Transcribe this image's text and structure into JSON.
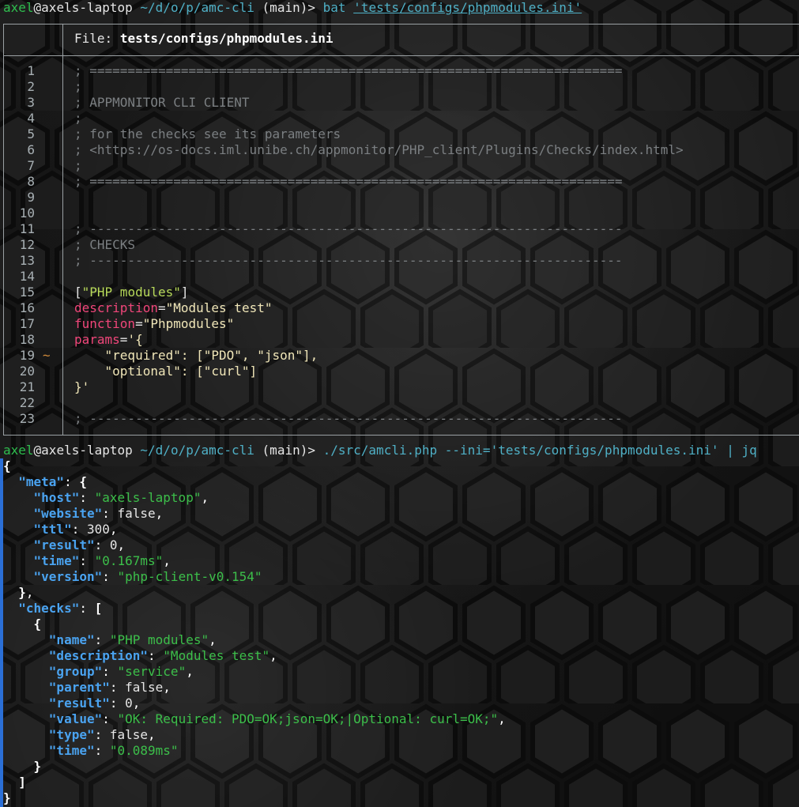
{
  "prompt1": {
    "user": "axel",
    "at": "@",
    "host": "axels-laptop",
    "cwd": "~/d/o/p/amc-cli",
    "branch": "(main)",
    "symbol": ">",
    "command": "bat",
    "argument": "'tests/configs/phpmodules.ini'"
  },
  "bat": {
    "file_label": "File:",
    "file_name": "tests/configs/phpmodules.ini",
    "line_numbers": [
      "1",
      "2",
      "3",
      "4",
      "5",
      "6",
      "7",
      "8",
      "9",
      "10",
      "11",
      "12",
      "13",
      "14",
      "15",
      "16",
      "17",
      "18",
      "19",
      "20",
      "21",
      "22",
      "23"
    ],
    "change_marker": "~",
    "lines": {
      "l1": "; ======================================================================",
      "l2": ";",
      "l3": "; APPMONITOR CLI CLIENT",
      "l4": ";",
      "l5": "; for the checks see its parameters",
      "l6": "; <https://os-docs.iml.unibe.ch/appmonitor/PHP_client/Plugins/Checks/index.html>",
      "l7": ";",
      "l8": "; ======================================================================",
      "l11": "; ----------------------------------------------------------------------",
      "l12": "; CHECKS",
      "l13": "; ----------------------------------------------------------------------",
      "l15_open": "[",
      "l15_name": "\"PHP modules\"",
      "l15_close": "]",
      "l16_key": "description",
      "l16_val": "\"Modules test\"",
      "l17_key": "function",
      "l17_val": "\"Phpmodules\"",
      "l18_key": "params",
      "l18_val": "'{",
      "l19": "    \"required\": [\"PDO\", \"json\"],",
      "l20": "    \"optional\": [\"curl\"]",
      "l21": "}'",
      "l23": "; ----------------------------------------------------------------------"
    }
  },
  "prompt2": {
    "user": "axel",
    "at": "@",
    "host": "axels-laptop",
    "cwd": "~/d/o/p/amc-cli",
    "branch": "(main)",
    "symbol": ">",
    "command": "./src/amcli.php",
    "option": "--ini='tests/configs/phpmodules.ini'",
    "pipe": "|",
    "pipe_cmd": "jq"
  },
  "json_output": {
    "meta": {
      "host": "\"axels-laptop\"",
      "website": "false",
      "ttl": "300",
      "result": "0",
      "time": "\"0.167ms\"",
      "version": "\"php-client-v0.154\""
    },
    "check": {
      "name": "\"PHP modules\"",
      "description": "\"Modules test\"",
      "group": "\"service\"",
      "parent": "false",
      "result": "0",
      "value": "\"OK: Required: PDO=OK;json=OK;|Optional: curl=OK;\"",
      "type": "false",
      "time": "\"0.089ms\""
    },
    "keys": {
      "meta": "\"meta\"",
      "host": "\"host\"",
      "website": "\"website\"",
      "ttl": "\"ttl\"",
      "result": "\"result\"",
      "time": "\"time\"",
      "version": "\"version\"",
      "checks": "\"checks\"",
      "name": "\"name\"",
      "description": "\"description\"",
      "group": "\"group\"",
      "parent": "\"parent\"",
      "value": "\"value\"",
      "type": "\"type\""
    }
  }
}
